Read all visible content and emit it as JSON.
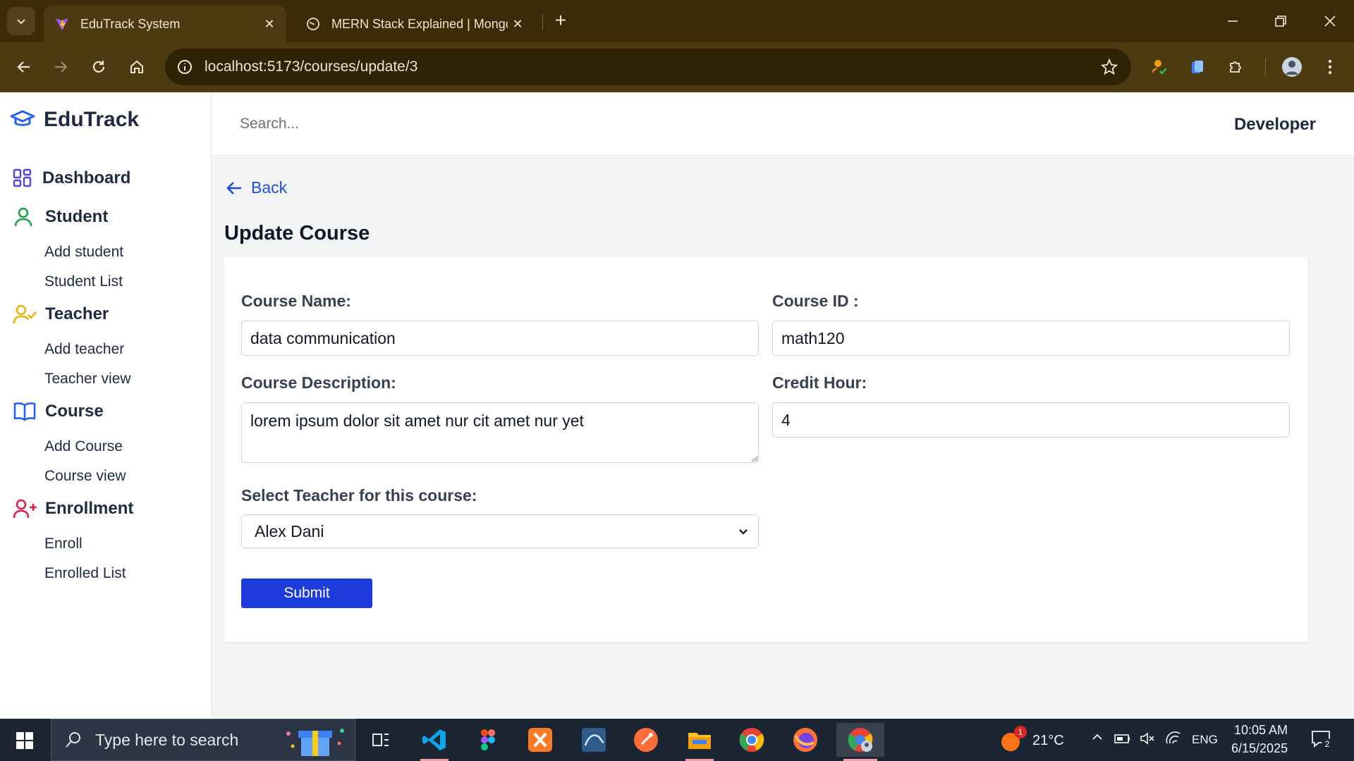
{
  "browser": {
    "tabs": [
      {
        "title": "EduTrack System",
        "active": true
      },
      {
        "title": "MERN Stack Explained | Mongo",
        "active": false
      }
    ],
    "url": "localhost:5173/courses/update/3"
  },
  "app": {
    "brand": "EduTrack",
    "search_placeholder": "Search...",
    "user_name": "Developer",
    "nav": {
      "dashboard": "Dashboard",
      "student": {
        "label": "Student",
        "items": [
          "Add student",
          "Student List"
        ]
      },
      "teacher": {
        "label": "Teacher",
        "items": [
          "Add teacher",
          "Teacher view"
        ]
      },
      "course": {
        "label": "Course",
        "items": [
          "Add Course",
          "Course view"
        ]
      },
      "enrollment": {
        "label": "Enrollment",
        "items": [
          "Enroll",
          "Enrolled List"
        ]
      }
    },
    "accent_colors": {
      "dashboard": "#4f46e5",
      "student": "#16a34a",
      "teacher": "#eab308",
      "course": "#2563eb",
      "enrollment": "#e11d48",
      "submit": "#1d3bdb"
    }
  },
  "form": {
    "back_label": "Back",
    "title": "Update Course",
    "course_name": {
      "label": "Course Name:",
      "value": "data communication"
    },
    "course_id": {
      "label": "Course ID :",
      "value": "math120"
    },
    "description": {
      "label": "Course Description:",
      "value": "lorem ipsum dolor sit amet nur cit amet nur yet"
    },
    "credit_hour": {
      "label": "Credit Hour:",
      "value": "4"
    },
    "teacher": {
      "label": "Select Teacher for this course:",
      "selected": "Alex Dani"
    },
    "submit_label": "Submit"
  },
  "taskbar": {
    "search_placeholder": "Type here to search",
    "weather": "21°C",
    "weather_badge": "1",
    "language": "ENG",
    "time": "10:05 AM",
    "date": "6/15/2025",
    "notification_count": "2"
  }
}
